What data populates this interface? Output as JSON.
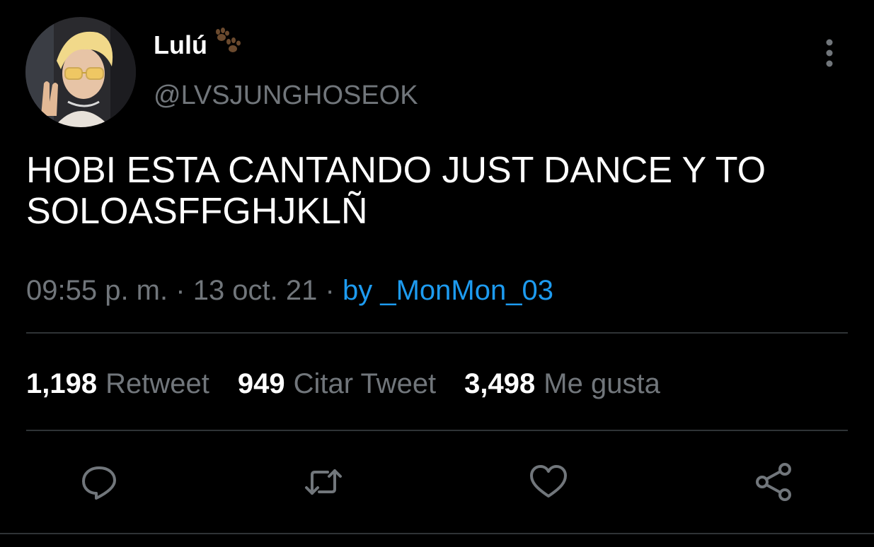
{
  "tweet": {
    "display_name": "Lulú",
    "handle": "@LVSJUNGHOSEOK",
    "text_line1": "HOBI ESTA CANTANDO JUST DANCE Y TO",
    "text_line2": "SOLOASFFGHJKLÑ",
    "time": "09:55 p. m.",
    "separator": "·",
    "date": "13 oct. 21",
    "source": "by _MonMon_03"
  },
  "stats": {
    "retweets_count": "1,198",
    "retweets_label": "Retweet",
    "quotes_count": "949",
    "quotes_label": "Citar Tweet",
    "likes_count": "3,498",
    "likes_label": "Me gusta"
  },
  "icons": {
    "name_emoji": "paw-prints-icon",
    "more": "more-vertical-icon",
    "reply": "reply-icon",
    "retweet": "retweet-icon",
    "like": "heart-icon",
    "share": "share-icon"
  },
  "colors": {
    "background": "#000000",
    "text": "#ffffff",
    "secondary": "#71767b",
    "link": "#1d9bf0",
    "divider": "#2f3336"
  }
}
